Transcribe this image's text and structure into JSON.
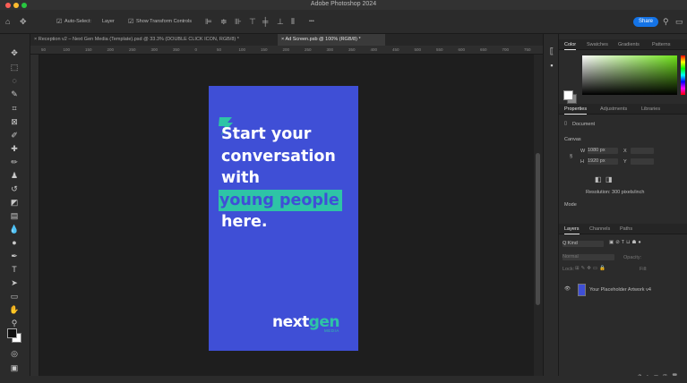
{
  "window": {
    "title": "Adobe Photoshop 2024"
  },
  "options_bar": {
    "auto_select_label": "Auto-Select:",
    "auto_select_value": "Layer",
    "show_transform_label": "Show Transform Controls",
    "more_label": "•••",
    "share_label": "Share"
  },
  "tabs": [
    {
      "label": "Reception v2 – Next Gen Media (Template).psd @ 33.3% (DOUBLE CLICK ICON, RGB/8) *",
      "active": false
    },
    {
      "label": "Ad Screen.psb @ 100% (RGB/8) *",
      "active": true
    }
  ],
  "ruler_ticks": [
    "50",
    "100",
    "150",
    "200",
    "250",
    "300",
    "350",
    "0",
    "50",
    "100",
    "150",
    "200",
    "250",
    "300",
    "350",
    "400",
    "450",
    "500",
    "550",
    "600",
    "650",
    "700",
    "750"
  ],
  "artboard": {
    "headline": [
      "Start your",
      "conversation",
      "with"
    ],
    "headline_accent": "young people",
    "headline_end": "here.",
    "brand_part1": "next",
    "brand_part2": "gen",
    "brand_sub": "MEDIA",
    "bg_color": "#3f4fd6",
    "accent_color": "#2ec4a6"
  },
  "color_panel": {
    "tabs": [
      "Color",
      "Swatches",
      "Gradients",
      "Patterns"
    ]
  },
  "properties_panel": {
    "tabs": [
      "Properties",
      "Adjustments",
      "Libraries"
    ],
    "doc_label": "Document",
    "canvas_label": "Canvas",
    "w_label": "W",
    "w_value": "1080 px",
    "h_label": "H",
    "h_value": "1920 px",
    "x_label": "X",
    "y_label": "Y",
    "resolution": "Resolution: 300 pixels/inch",
    "mode": "Mode"
  },
  "layers_panel": {
    "tabs": [
      "Layers",
      "Channels",
      "Paths"
    ],
    "kind": "Q Kind",
    "normal": "Normal",
    "opacity": "Opacity:",
    "lock": "Lock:",
    "fill": "Fill:",
    "layer_name": "Your Placeholder Artwork v4"
  }
}
